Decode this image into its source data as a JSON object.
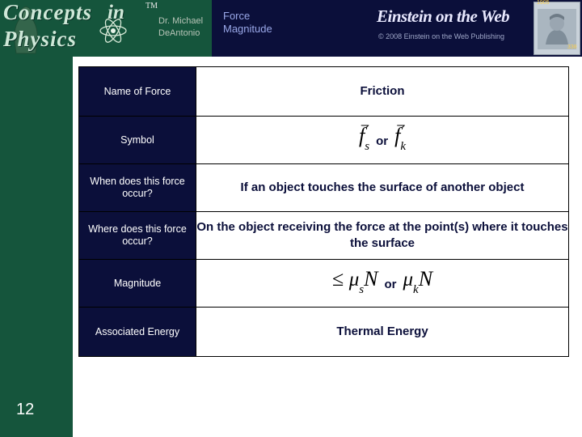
{
  "header": {
    "brand_line1": "Concepts",
    "brand_in": "in",
    "brand_line2": "Physics",
    "trademark": "TM",
    "author_line1": "Dr. Michael",
    "author_line2": "DeAntonio",
    "title_line1": "Force",
    "title_line2": "Magnitude",
    "publisher_logo": "Einstein on the Web",
    "copyright": "© 2008 Einstein on the Web Publishing",
    "photo_caption": "1905",
    "photo_number": "338",
    "colors": {
      "header_bg": "#0b0f3a",
      "band_green": "#15553c",
      "title_text": "#9aa8e8",
      "accent_yellow": "#ffd24d"
    }
  },
  "table": {
    "rows": [
      {
        "label": "Name of Force",
        "value": "Friction",
        "type": "text"
      },
      {
        "label": "Symbol",
        "value": "",
        "type": "math-symbol",
        "math": {
          "left_base": "f",
          "left_sub": "s",
          "conjunction": "or",
          "right_base": "f",
          "right_sub": "k"
        }
      },
      {
        "label": "When does this force occur?",
        "value": "If an object touches the surface of another object",
        "type": "text"
      },
      {
        "label": "Where does this force occur?",
        "value": "On the object receiving the force at the point(s) where it touches the surface",
        "type": "text"
      },
      {
        "label": "Magnitude",
        "value": "",
        "type": "math-magnitude",
        "math": {
          "left": "≤ μₛN",
          "conjunction": "or",
          "right": "μₖN",
          "left_symbol": "≤",
          "left_mu": "μ",
          "left_mu_sub": "s",
          "left_N": "N",
          "right_mu": "μ",
          "right_mu_sub": "k",
          "right_N": "N"
        }
      },
      {
        "label": "Associated Energy",
        "value": "Thermal Energy",
        "type": "text"
      }
    ]
  },
  "slide": {
    "number": "12"
  }
}
